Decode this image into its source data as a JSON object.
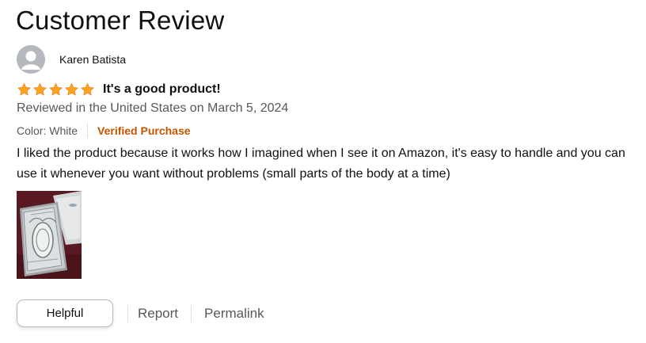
{
  "page": {
    "title": "Customer Review"
  },
  "profile": {
    "name": "Karen Batista",
    "avatar_icon": "user-silhouette-icon"
  },
  "review": {
    "rating": 5,
    "rating_max": 5,
    "star_color": "#ffa41c",
    "title": "It's a good product!",
    "date": "Reviewed in the United States on March 5, 2024",
    "color_variant": "Color: White",
    "badge": "Verified Purchase",
    "badge_color": "#c45500",
    "body": "I liked the product because it works how I imagined when I see it on Amazon, it's easy to handle and you can use it whenever you want without problems (small parts of the body at a time)"
  },
  "actions": {
    "helpful_label": "Helpful",
    "report_label": "Report",
    "permalink_label": "Permalink"
  }
}
